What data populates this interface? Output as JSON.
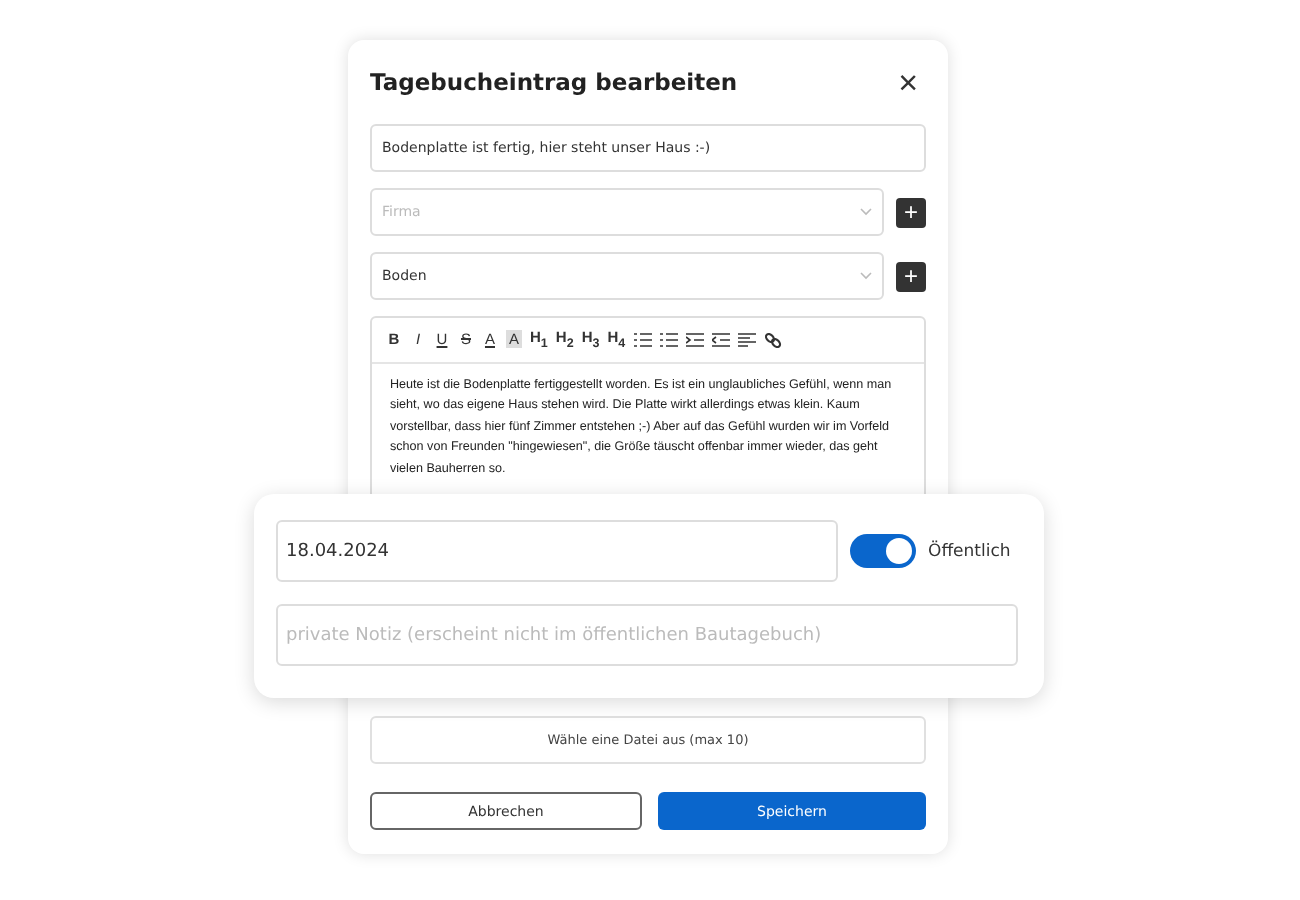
{
  "dialog": {
    "title": "Tagebucheintrag bearbeiten",
    "close": "×",
    "title_field": {
      "value": "Bodenplatte ist fertig, hier steht unser Haus :-)"
    },
    "selects": [
      {
        "placeholder": "Firma"
      },
      {
        "value": "Boden"
      }
    ],
    "add_symbol": "+",
    "toolbar": [
      {
        "kind": "bold",
        "label": "B"
      },
      {
        "kind": "italic",
        "label": "I"
      },
      {
        "kind": "underline",
        "label": "U"
      },
      {
        "kind": "strike",
        "label": "S"
      },
      {
        "kind": "color",
        "label": "A"
      },
      {
        "kind": "highlight",
        "label": "A"
      },
      {
        "kind": "heading",
        "label": "H$_{1}$"
      },
      {
        "kind": "heading",
        "label": "H$_{2}$"
      },
      {
        "kind": "heading",
        "label": "H$_{3}$"
      },
      {
        "kind": "heading",
        "label": "H$_{4}$"
      },
      {
        "kind": "bullet-list"
      },
      {
        "kind": "numbered-list"
      },
      {
        "kind": "indent"
      },
      {
        "kind": "outdent"
      },
      {
        "kind": "align"
      },
      {
        "kind": "link"
      }
    ],
    "body": "Heute ist die Bodenplatte fertiggestellt worden. Es ist ein unglaubliches Gefühl, wenn man sieht, wo das eigene Haus stehen wird. Die Platte wirkt allerdings etwas klein. Kaum vorstellbar, dass hier fünf Zimmer entstehen ;-) Aber auf das Gefühl wurden wir im Vorfeld schon von Freunden \"hingewiesen\", die Größe täuscht offenbar immer wieder, das geht vielen Bauherren so.",
    "file_button": "Wähle eine Datei aus (max 10)",
    "buttons": [
      {
        "kind": "secondary",
        "label": "Abbrechen"
      },
      {
        "kind": "primary",
        "label": "Speichern"
      }
    ]
  },
  "overlay": {
    "date": "18.04.2024",
    "public": {
      "label": "Öffentlich",
      "on": true
    },
    "note": {
      "placeholder": "private Notiz (erscheint nicht im öffentlichen Bautagebuch)"
    }
  }
}
